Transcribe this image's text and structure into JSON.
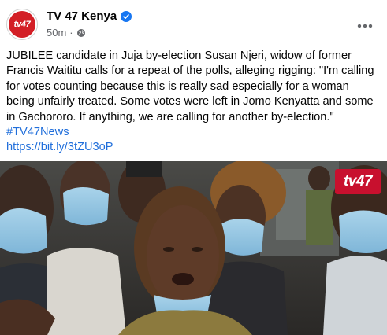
{
  "post": {
    "page_name": "TV 47 Kenya",
    "timestamp": "50m",
    "separator": "·",
    "avatar_logo_text": "tv47",
    "verified_icon": "verified-badge-icon",
    "privacy_icon": "globe-icon",
    "more_icon": "more-options-icon",
    "text_main": "JUBILEE candidate in Juja by-election Susan Njeri, widow of former Francis Waititu calls for a repeat of the polls, alleging rigging:  \"I'm calling for votes counting because this is really sad especially for a woman being unfairly treated. Some votes were left in Jomo Kenyatta and some in Gachororo. If anything, we are calling for another by-election.\" ",
    "hashtag": "#TV47News",
    "link": "https://bit.ly/3tZU3oP",
    "photo_watermark": "tv47"
  },
  "colors": {
    "brand_red": "#d31f26",
    "verified_blue": "#1877f2",
    "link_blue": "#216fdb",
    "meta_gray": "#65676b"
  }
}
